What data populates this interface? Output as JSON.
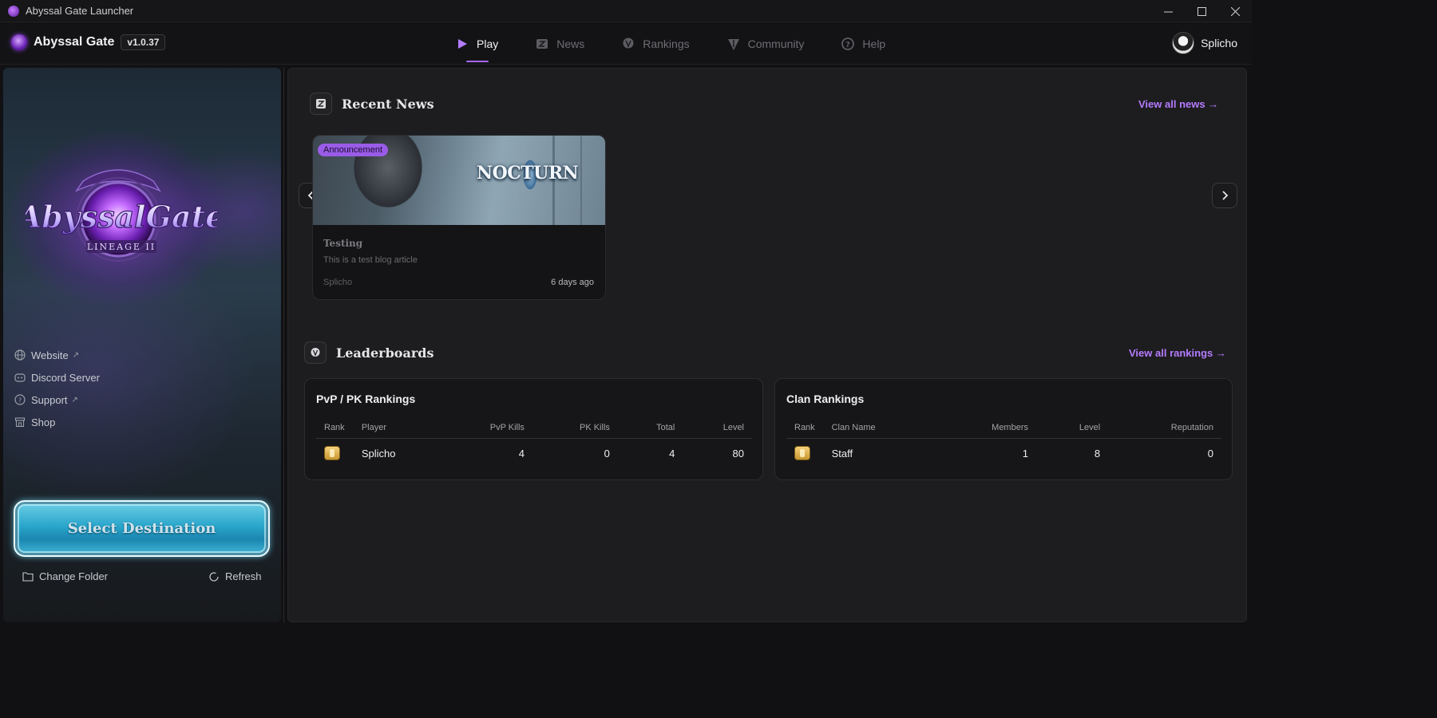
{
  "window": {
    "title": "Abyssal Gate Launcher"
  },
  "brand": {
    "name": "Abyssal Gate",
    "version": "v1.0.37"
  },
  "nav": {
    "tabs": [
      {
        "label": "Play",
        "icon": "play-icon",
        "active": true
      },
      {
        "label": "News",
        "icon": "scroll-icon",
        "active": false
      },
      {
        "label": "Rankings",
        "icon": "trophy-icon",
        "active": false
      },
      {
        "label": "Community",
        "icon": "community-icon",
        "active": false
      },
      {
        "label": "Help",
        "icon": "help-icon",
        "active": false
      }
    ]
  },
  "user": {
    "name": "Splicho"
  },
  "sidebar": {
    "links": [
      {
        "label": "Website",
        "icon": "globe-icon",
        "external": true
      },
      {
        "label": "Discord Server",
        "icon": "discord-icon",
        "external": false
      },
      {
        "label": "Support",
        "icon": "help-icon",
        "external": true
      },
      {
        "label": "Shop",
        "icon": "store-icon",
        "external": false
      }
    ],
    "primary_button": "Select Destination",
    "change_folder": "Change Folder",
    "refresh": "Refresh"
  },
  "news": {
    "section_title": "Recent News",
    "view_all": "View all news →",
    "card": {
      "badge": "Announcement",
      "image_text": "NOCTURN",
      "title": "Testing",
      "description": "This is a test blog article",
      "author": "Splicho",
      "date": "6 days ago"
    }
  },
  "leaderboards": {
    "section_title": "Leaderboards",
    "view_all": "View all rankings →",
    "pvp": {
      "title": "PvP / PK Rankings",
      "columns": [
        "Rank",
        "Player",
        "PvP Kills",
        "PK Kills",
        "Total",
        "Level"
      ],
      "rows": [
        {
          "player": "Splicho",
          "pvp_kills": "4",
          "pk_kills": "0",
          "total": "4",
          "level": "80"
        }
      ]
    },
    "clan": {
      "title": "Clan Rankings",
      "columns": [
        "Rank",
        "Clan Name",
        "Members",
        "Level",
        "Reputation"
      ],
      "rows": [
        {
          "clan": "Staff",
          "members": "1",
          "level": "8",
          "reputation": "0"
        }
      ]
    }
  },
  "colors": {
    "accent": "#a864ff",
    "link": "#b57bff",
    "button": "#2aa6cc"
  }
}
